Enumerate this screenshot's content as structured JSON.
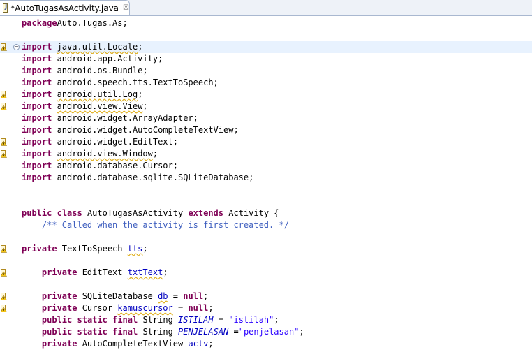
{
  "tab": {
    "title": "*AutoTugasAsActivity.java",
    "close_glyph": "☒"
  },
  "editor": {
    "fold_glyph": "−",
    "lines": [
      {
        "row": 0,
        "warn": false,
        "tokens": [
          [
            "kw",
            "package"
          ],
          [
            "",
            "Auto.Tugas.As;"
          ]
        ]
      },
      {
        "row": 2,
        "warn": true,
        "fold": true,
        "hl": true,
        "tokens": [
          [
            "kw",
            "import"
          ],
          [
            "",
            " "
          ],
          [
            "w",
            "java.util.Locale"
          ],
          [
            "",
            ";"
          ]
        ]
      },
      {
        "row": 3,
        "warn": false,
        "tokens": [
          [
            "kw",
            "import"
          ],
          [
            "",
            " android.app.Activity;"
          ]
        ]
      },
      {
        "row": 4,
        "warn": false,
        "tokens": [
          [
            "kw",
            "import"
          ],
          [
            "",
            " android.os.Bundle;"
          ]
        ]
      },
      {
        "row": 5,
        "warn": false,
        "tokens": [
          [
            "kw",
            "import"
          ],
          [
            "",
            " android.speech.tts.TextToSpeech;"
          ]
        ]
      },
      {
        "row": 6,
        "warn": true,
        "tokens": [
          [
            "kw",
            "import"
          ],
          [
            "",
            " "
          ],
          [
            "w",
            "android.util.Log"
          ],
          [
            "",
            ";"
          ]
        ]
      },
      {
        "row": 7,
        "warn": true,
        "tokens": [
          [
            "kw",
            "import"
          ],
          [
            "",
            " "
          ],
          [
            "w",
            "android.view.View"
          ],
          [
            "",
            ";"
          ]
        ]
      },
      {
        "row": 8,
        "warn": false,
        "tokens": [
          [
            "kw",
            "import"
          ],
          [
            "",
            " android.widget.ArrayAdapter;"
          ]
        ]
      },
      {
        "row": 9,
        "warn": false,
        "tokens": [
          [
            "kw",
            "import"
          ],
          [
            "",
            " android.widget.AutoCompleteTextView;"
          ]
        ]
      },
      {
        "row": 10,
        "warn": true,
        "tokens": [
          [
            "kw",
            "import"
          ],
          [
            "",
            " android.widget.EditText;"
          ]
        ]
      },
      {
        "row": 11,
        "warn": true,
        "tokens": [
          [
            "kw",
            "import"
          ],
          [
            "",
            " "
          ],
          [
            "w",
            "android.view.Window"
          ],
          [
            "",
            ";"
          ]
        ]
      },
      {
        "row": 12,
        "warn": false,
        "tokens": [
          [
            "kw",
            "import"
          ],
          [
            "",
            " android.database.Cursor;"
          ]
        ]
      },
      {
        "row": 13,
        "warn": false,
        "tokens": [
          [
            "kw",
            "import"
          ],
          [
            "",
            " android.database.sqlite.SQLiteDatabase;"
          ]
        ]
      },
      {
        "row": 16,
        "warn": false,
        "tokens": [
          [
            "kw",
            "public"
          ],
          [
            "",
            " "
          ],
          [
            "kw",
            "class"
          ],
          [
            "",
            " AutoTugasAsActivity "
          ],
          [
            "kw",
            "extends"
          ],
          [
            "",
            " Activity {"
          ]
        ]
      },
      {
        "row": 17,
        "warn": false,
        "tokens": [
          [
            "",
            "    "
          ],
          [
            "cmt",
            "/** Called when the activity is first created. */"
          ]
        ]
      },
      {
        "row": 19,
        "warn": true,
        "tokens": [
          [
            "kw",
            "private"
          ],
          [
            "",
            " TextToSpeech "
          ],
          [
            "wf",
            "tts"
          ],
          [
            "",
            ";"
          ]
        ]
      },
      {
        "row": 21,
        "warn": true,
        "tokens": [
          [
            "",
            "    "
          ],
          [
            "kw",
            "private"
          ],
          [
            "",
            " EditText "
          ],
          [
            "wf",
            "txtText"
          ],
          [
            "",
            ";"
          ]
        ]
      },
      {
        "row": 23,
        "warn": true,
        "tokens": [
          [
            "",
            "    "
          ],
          [
            "kw",
            "private"
          ],
          [
            "",
            " SQLiteDatabase "
          ],
          [
            "wf",
            "db"
          ],
          [
            "",
            " = "
          ],
          [
            "kw",
            "null"
          ],
          [
            "",
            ";"
          ]
        ]
      },
      {
        "row": 24,
        "warn": true,
        "tokens": [
          [
            "",
            "    "
          ],
          [
            "kw",
            "private"
          ],
          [
            "",
            " Cursor "
          ],
          [
            "wf",
            "kamuscursor"
          ],
          [
            "",
            " = "
          ],
          [
            "kw",
            "null"
          ],
          [
            "",
            ";"
          ]
        ]
      },
      {
        "row": 25,
        "warn": false,
        "tokens": [
          [
            "",
            "    "
          ],
          [
            "kw",
            "public"
          ],
          [
            "",
            " "
          ],
          [
            "kw",
            "static"
          ],
          [
            "",
            " "
          ],
          [
            "kw",
            "final"
          ],
          [
            "",
            " String "
          ],
          [
            "sfld",
            "ISTILAH"
          ],
          [
            "",
            " = "
          ],
          [
            "str",
            "\"istilah\""
          ],
          [
            "",
            ";"
          ]
        ]
      },
      {
        "row": 26,
        "warn": false,
        "tokens": [
          [
            "",
            "    "
          ],
          [
            "kw",
            "public"
          ],
          [
            "",
            " "
          ],
          [
            "kw",
            "static"
          ],
          [
            "",
            " "
          ],
          [
            "kw",
            "final"
          ],
          [
            "",
            " String "
          ],
          [
            "sfld",
            "PENJELASAN"
          ],
          [
            "",
            " ="
          ],
          [
            "str",
            "\"penjelasan\""
          ],
          [
            "",
            ";"
          ]
        ]
      },
      {
        "row": 27,
        "warn": false,
        "tokens": [
          [
            "",
            "    "
          ],
          [
            "kw",
            "private"
          ],
          [
            "",
            " AutoCompleteTextView "
          ],
          [
            "fld",
            "actv"
          ],
          [
            "",
            ";"
          ]
        ]
      }
    ]
  }
}
